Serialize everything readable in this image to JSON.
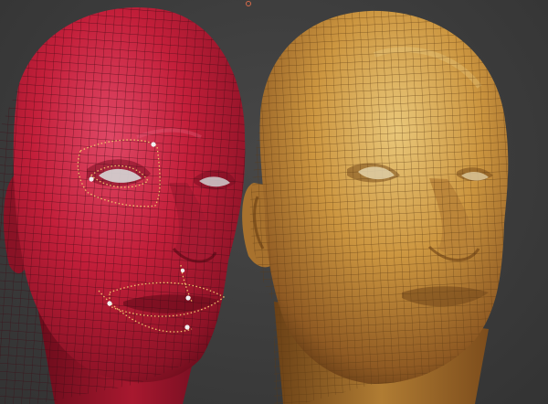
{
  "viewport": {
    "background": "#3a3a3a",
    "title": ""
  },
  "models": [
    {
      "name": "left-head-red",
      "base_color": "#c8203b",
      "shade_color": "#7a0f22",
      "highlight_color": "#e8587a",
      "wire_color": "#3b0a14",
      "selection": {
        "polygroup_regions": [
          "eye-socket",
          "mouth-nasolabial"
        ],
        "marker_color": "#f2c36b",
        "point_color": "#f0f0f0"
      }
    },
    {
      "name": "right-head-gold",
      "base_color": "#c9933c",
      "shade_color": "#7a4d1d",
      "highlight_color": "#e8c676",
      "wire_color": "#5a3813"
    }
  ],
  "top_gizmo_icon": "transform-gizmo-icon"
}
